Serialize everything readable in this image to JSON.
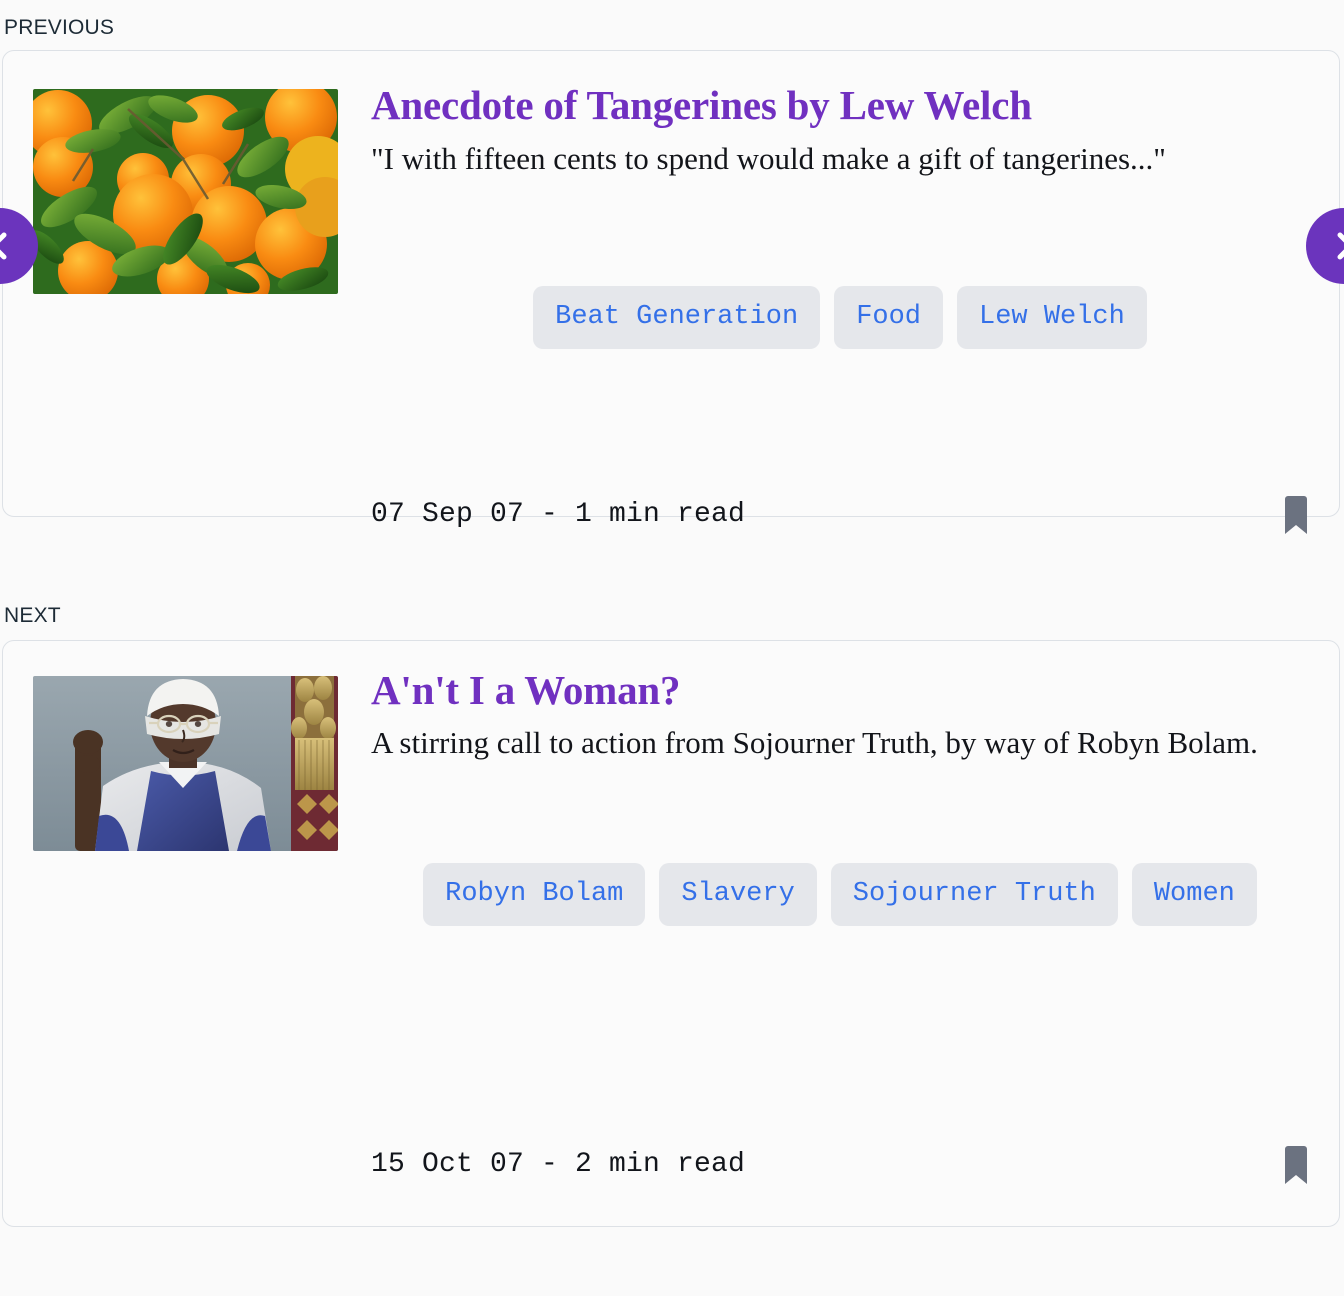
{
  "labels": {
    "previous": "PREVIOUS",
    "next": "NEXT"
  },
  "nav": {
    "prev_button": "chevron-left-icon",
    "next_button": "chevron-right-icon"
  },
  "colors": {
    "title_purple": "#7030c0",
    "tag_text_blue": "#3470e8",
    "tag_background": "#e5e7eb",
    "nav_circle_purple": "#6b34bd",
    "bookmark_gray": "#6b7280",
    "page_background": "#fafafa",
    "card_border": "#dde1e6"
  },
  "previous_post": {
    "title": "Anecdote of Tangerines by Lew Welch",
    "excerpt": "\"I with fifteen cents to spend would make a gift of tangerines...\"",
    "thumbnail_alt": "tangerines-photo",
    "tags": [
      "Beat Generation",
      "Food",
      "Lew Welch"
    ],
    "date": "07 Sep 07",
    "separator": " - ",
    "read_time": "1 min read",
    "meta": "07 Sep 07 - 1 min read",
    "bookmark": "bookmark-icon"
  },
  "next_post": {
    "title": "A'n't I a Woman?",
    "excerpt": "A stirring call to action from Sojourner Truth, by way of Robyn Bolam.",
    "thumbnail_alt": "sojourner-truth-portrait",
    "tags": [
      "Robyn Bolam",
      "Slavery",
      "Sojourner Truth",
      "Women"
    ],
    "date": "15 Oct 07",
    "separator": " - ",
    "read_time": "2 min read",
    "meta": "15 Oct 07 - 2 min read",
    "bookmark": "bookmark-icon"
  }
}
